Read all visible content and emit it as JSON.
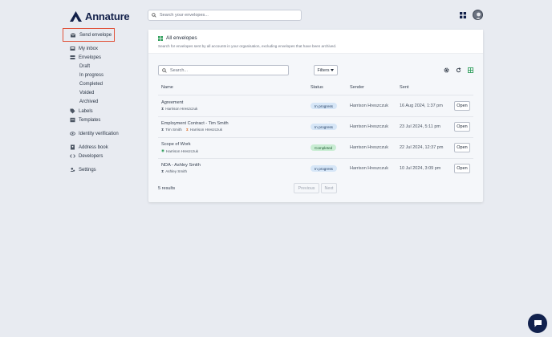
{
  "brand": {
    "name": "Annature"
  },
  "header": {
    "search_placeholder": "Search your envelopes..."
  },
  "sidebar": {
    "send": "Send envelope",
    "my_inbox": "My inbox",
    "envelopes": "Envelopes",
    "envelope_items": [
      "Draft",
      "In progress",
      "Completed",
      "Voided",
      "Archived"
    ],
    "labels": "Labels",
    "templates": "Templates",
    "identity": "Identity verification",
    "address_book": "Address book",
    "developers": "Developers",
    "settings": "Settings"
  },
  "panel": {
    "title": "All envelopes",
    "description": "Search for envelopes sent by all accounts in your organisation, excluding envelopes that have been archived.",
    "search_placeholder": "Search...",
    "filters": "Filters",
    "columns": [
      "Name",
      "Status",
      "Sender",
      "Sent"
    ],
    "rows": [
      {
        "name": "Agreement",
        "signers": [
          "Harrison Hreszczuk"
        ],
        "signer_icons": [
          "hourglass"
        ],
        "status": "In progress",
        "sender": "Harrison Hreszczuk",
        "sent": "16 Aug 2024, 1:37 pm",
        "action": "Open"
      },
      {
        "name": "Employment Contract - Tim Smith",
        "signers": [
          "Tim Smith",
          "Harrison Hreszczuk"
        ],
        "signer_icons": [
          "hourglass",
          "hourglass-orange"
        ],
        "status": "In progress",
        "sender": "Harrison Hreszczuk",
        "sent": "23 Jul 2024, 5:11 pm",
        "action": "Open"
      },
      {
        "name": "Scope of Work",
        "signers": [
          "Harrison Hreszczuk"
        ],
        "signer_icons": [
          "check-circle"
        ],
        "status": "Completed",
        "sender": "Harrison Hreszczuk",
        "sent": "22 Jul 2024, 12:37 pm",
        "action": "Open"
      },
      {
        "name": "NDA - Ashley Smith",
        "signers": [
          "Ashley Smith"
        ],
        "signer_icons": [
          "hourglass"
        ],
        "status": "In progress",
        "sender": "Harrison Hreszczuk",
        "sent": "10 Jul 2024, 3:09 pm",
        "action": "Open"
      }
    ],
    "results": "5 results",
    "previous": "Previous",
    "next": "Next"
  },
  "colors": {
    "brand_navy": "#12204a",
    "in_progress_bg": "#d6e6f7",
    "completed_bg": "#c9edd3",
    "highlight_border": "#e0523a",
    "accent_green": "#2f9e5b"
  }
}
